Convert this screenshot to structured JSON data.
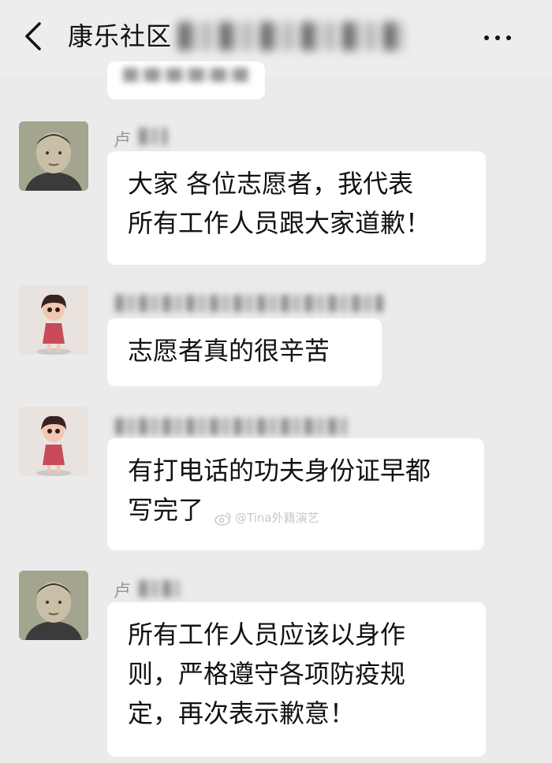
{
  "header": {
    "title": "康乐社区",
    "back_icon": "chevron-left-icon",
    "more_icon": "more-dots-icon"
  },
  "messages": [
    {
      "sender": "卢",
      "avatar": "man-avatar",
      "text_lines": [
        "大家 各位志愿者，我代表",
        "所有工作人员跟大家道歉！"
      ]
    },
    {
      "sender": "",
      "avatar": "girl-avatar",
      "text_lines": [
        "志愿者真的很辛苦"
      ]
    },
    {
      "sender": "",
      "avatar": "girl-avatar",
      "text_lines": [
        "有打电话的功夫身份证早都",
        "写完了"
      ]
    },
    {
      "sender": "卢",
      "avatar": "man-avatar",
      "text_lines": [
        "所有工作人员应该以身作",
        "则，严格遵守各项防疫规",
        "定，再次表示歉意！"
      ]
    }
  ],
  "watermark": "@Tina外籍演艺"
}
